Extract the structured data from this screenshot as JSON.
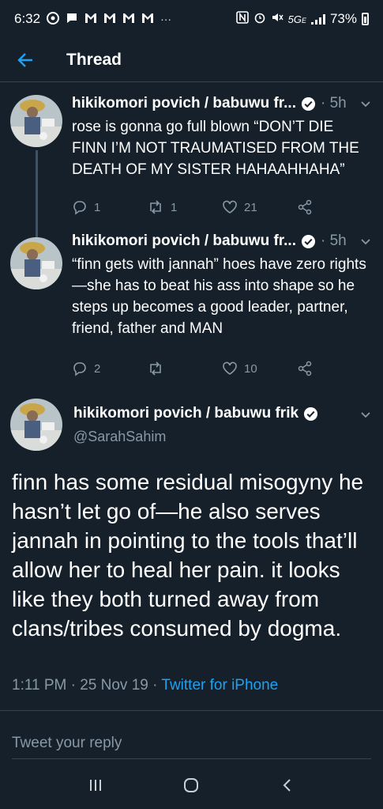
{
  "status_bar": {
    "time": "6:32",
    "network": "5G",
    "network_suffix": "E",
    "battery": "73%"
  },
  "header": {
    "title": "Thread"
  },
  "tweets": [
    {
      "name": "hikikomori povich / babuwu fr...",
      "time": "5h",
      "text": "rose is gonna go full blown “DON’T DIE FINN I’M NOT TRAUMATISED FROM THE DEATH OF MY SISTER HAHAAHHAHA”",
      "replies": "1",
      "retweets": "1",
      "likes": "21"
    },
    {
      "name": "hikikomori povich / babuwu fr...",
      "time": "5h",
      "text": "“finn gets with jannah” hoes have zero rights—she has to beat his ass into shape so he steps up becomes a good leader, partner, friend, father and MAN",
      "replies": "2",
      "retweets": "",
      "likes": "10"
    }
  ],
  "main_tweet": {
    "name": "hikikomori povich / babuwu frik",
    "handle": "@SarahSahim",
    "text": "finn has some residual misogyny he hasn’t let go of—he also serves jannah in pointing to the tools that’ll allow her to heal her pain. it looks like they both turned away from clans/tribes consumed by dogma.",
    "timestamp": "1:11 PM · 25 Nov 19 · ",
    "source": "Twitter for iPhone"
  },
  "reply": {
    "placeholder": "Tweet your reply"
  },
  "icons": {
    "accent": "#1da1f2",
    "background": "#15202b",
    "muted": "#8899a6"
  }
}
